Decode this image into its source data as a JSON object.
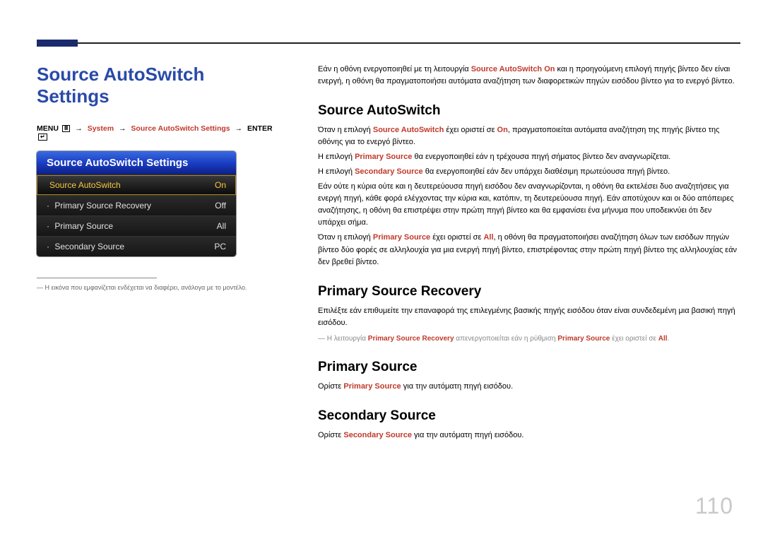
{
  "page_number": "110",
  "title": "Source AutoSwitch Settings",
  "breadcrumb": {
    "menu": "MENU",
    "system": "System",
    "item": "Source AutoSwitch Settings",
    "enter": "ENTER",
    "arrow": "→"
  },
  "osd": {
    "header": "Source AutoSwitch Settings",
    "rows": [
      {
        "label": "Source AutoSwitch",
        "value": "On",
        "selected": true,
        "prefix": ""
      },
      {
        "label": "Primary Source Recovery",
        "value": "Off",
        "selected": false,
        "prefix": "· "
      },
      {
        "label": "Primary Source",
        "value": "All",
        "selected": false,
        "prefix": "· "
      },
      {
        "label": "Secondary Source",
        "value": "PC",
        "selected": false,
        "prefix": "· "
      }
    ]
  },
  "left_note_dash": "―",
  "left_note": "Η εικόνα που εμφανίζεται ενδέχεται να διαφέρει, ανάλογα με το μοντέλο.",
  "intro": {
    "t1": "Εάν η οθόνη ενεργοποιηθεί με τη λειτουργία ",
    "kw1": "Source AutoSwitch On",
    "t2": " και η προηγούμενη επιλογή πηγής βίντεο δεν είναι ενεργή, η οθόνη θα πραγματοποιήσει αυτόματα αναζήτηση των διαφορετικών πηγών εισόδου βίντεο για το ενεργό βίντεο."
  },
  "sections": {
    "sa": {
      "h": "Source AutoSwitch",
      "p1a": "Όταν η επιλογή ",
      "p1kw1": "Source AutoSwitch",
      "p1b": " έχει οριστεί σε ",
      "p1kw2": "On",
      "p1c": ", πραγματοποιείται αυτόματα αναζήτηση της πηγής βίντεο της οθόνης για το ενεργό βίντεο.",
      "p2a": "Η επιλογή ",
      "p2kw": "Primary Source",
      "p2b": " θα ενεργοποιηθεί εάν η τρέχουσα πηγή σήματος βίντεο δεν αναγνωρίζεται.",
      "p3a": "Η επιλογή ",
      "p3kw": "Secondary Source",
      "p3b": " θα ενεργοποιηθεί εάν δεν υπάρχει διαθέσιμη πρωτεύουσα πηγή βίντεο.",
      "p4": "Εάν ούτε η κύρια ούτε και η δευτερεύουσα πηγή εισόδου δεν αναγνωρίζονται, η οθόνη θα εκτελέσει δυο αναζητήσεις για ενεργή πηγή, κάθε φορά ελέγχοντας την κύρια και, κατόπιν, τη δευτερεύουσα πηγή. Εάν αποτύχουν και οι δύο απόπειρες αναζήτησης, η οθόνη θα επιστρέψει στην πρώτη πηγή βίντεο και θα εμφανίσει ένα μήνυμα που υποδεικνύει ότι δεν υπάρχει σήμα.",
      "p5a": "Όταν η επιλογή ",
      "p5kw1": "Primary Source",
      "p5b": " έχει οριστεί σε ",
      "p5kw2": "All",
      "p5c": ", η οθόνη θα πραγματοποιήσει αναζήτηση όλων των εισόδων πηγών βίντεο δύο φορές σε αλληλουχία για μια ενεργή πηγή βίντεο, επιστρέφοντας στην πρώτη πηγή βίντεο της αλληλουχίας εάν δεν βρεθεί βίντεο."
    },
    "psr": {
      "h": "Primary Source Recovery",
      "p": "Επιλέξτε εάν επιθυμείτε την επαναφορά της επιλεγμένης βασικής πηγής εισόδου όταν είναι συνδεδεμένη μια βασική πηγή εισόδου.",
      "note_a": "― Η λειτουργία ",
      "note_kw1": "Primary Source Recovery",
      "note_b": " απενεργοποιείται εάν η ρύθμιση ",
      "note_kw2": "Primary Source",
      "note_c": " έχει οριστεί σε ",
      "note_kw3": "All",
      "note_d": "."
    },
    "ps": {
      "h": "Primary Source",
      "pa": "Ορίστε ",
      "kw": "Primary Source",
      "pb": " για την αυτόματη πηγή εισόδου."
    },
    "ss": {
      "h": "Secondary Source",
      "pa": "Ορίστε ",
      "kw": "Secondary Source",
      "pb": " για την αυτόματη πηγή εισόδου."
    }
  }
}
